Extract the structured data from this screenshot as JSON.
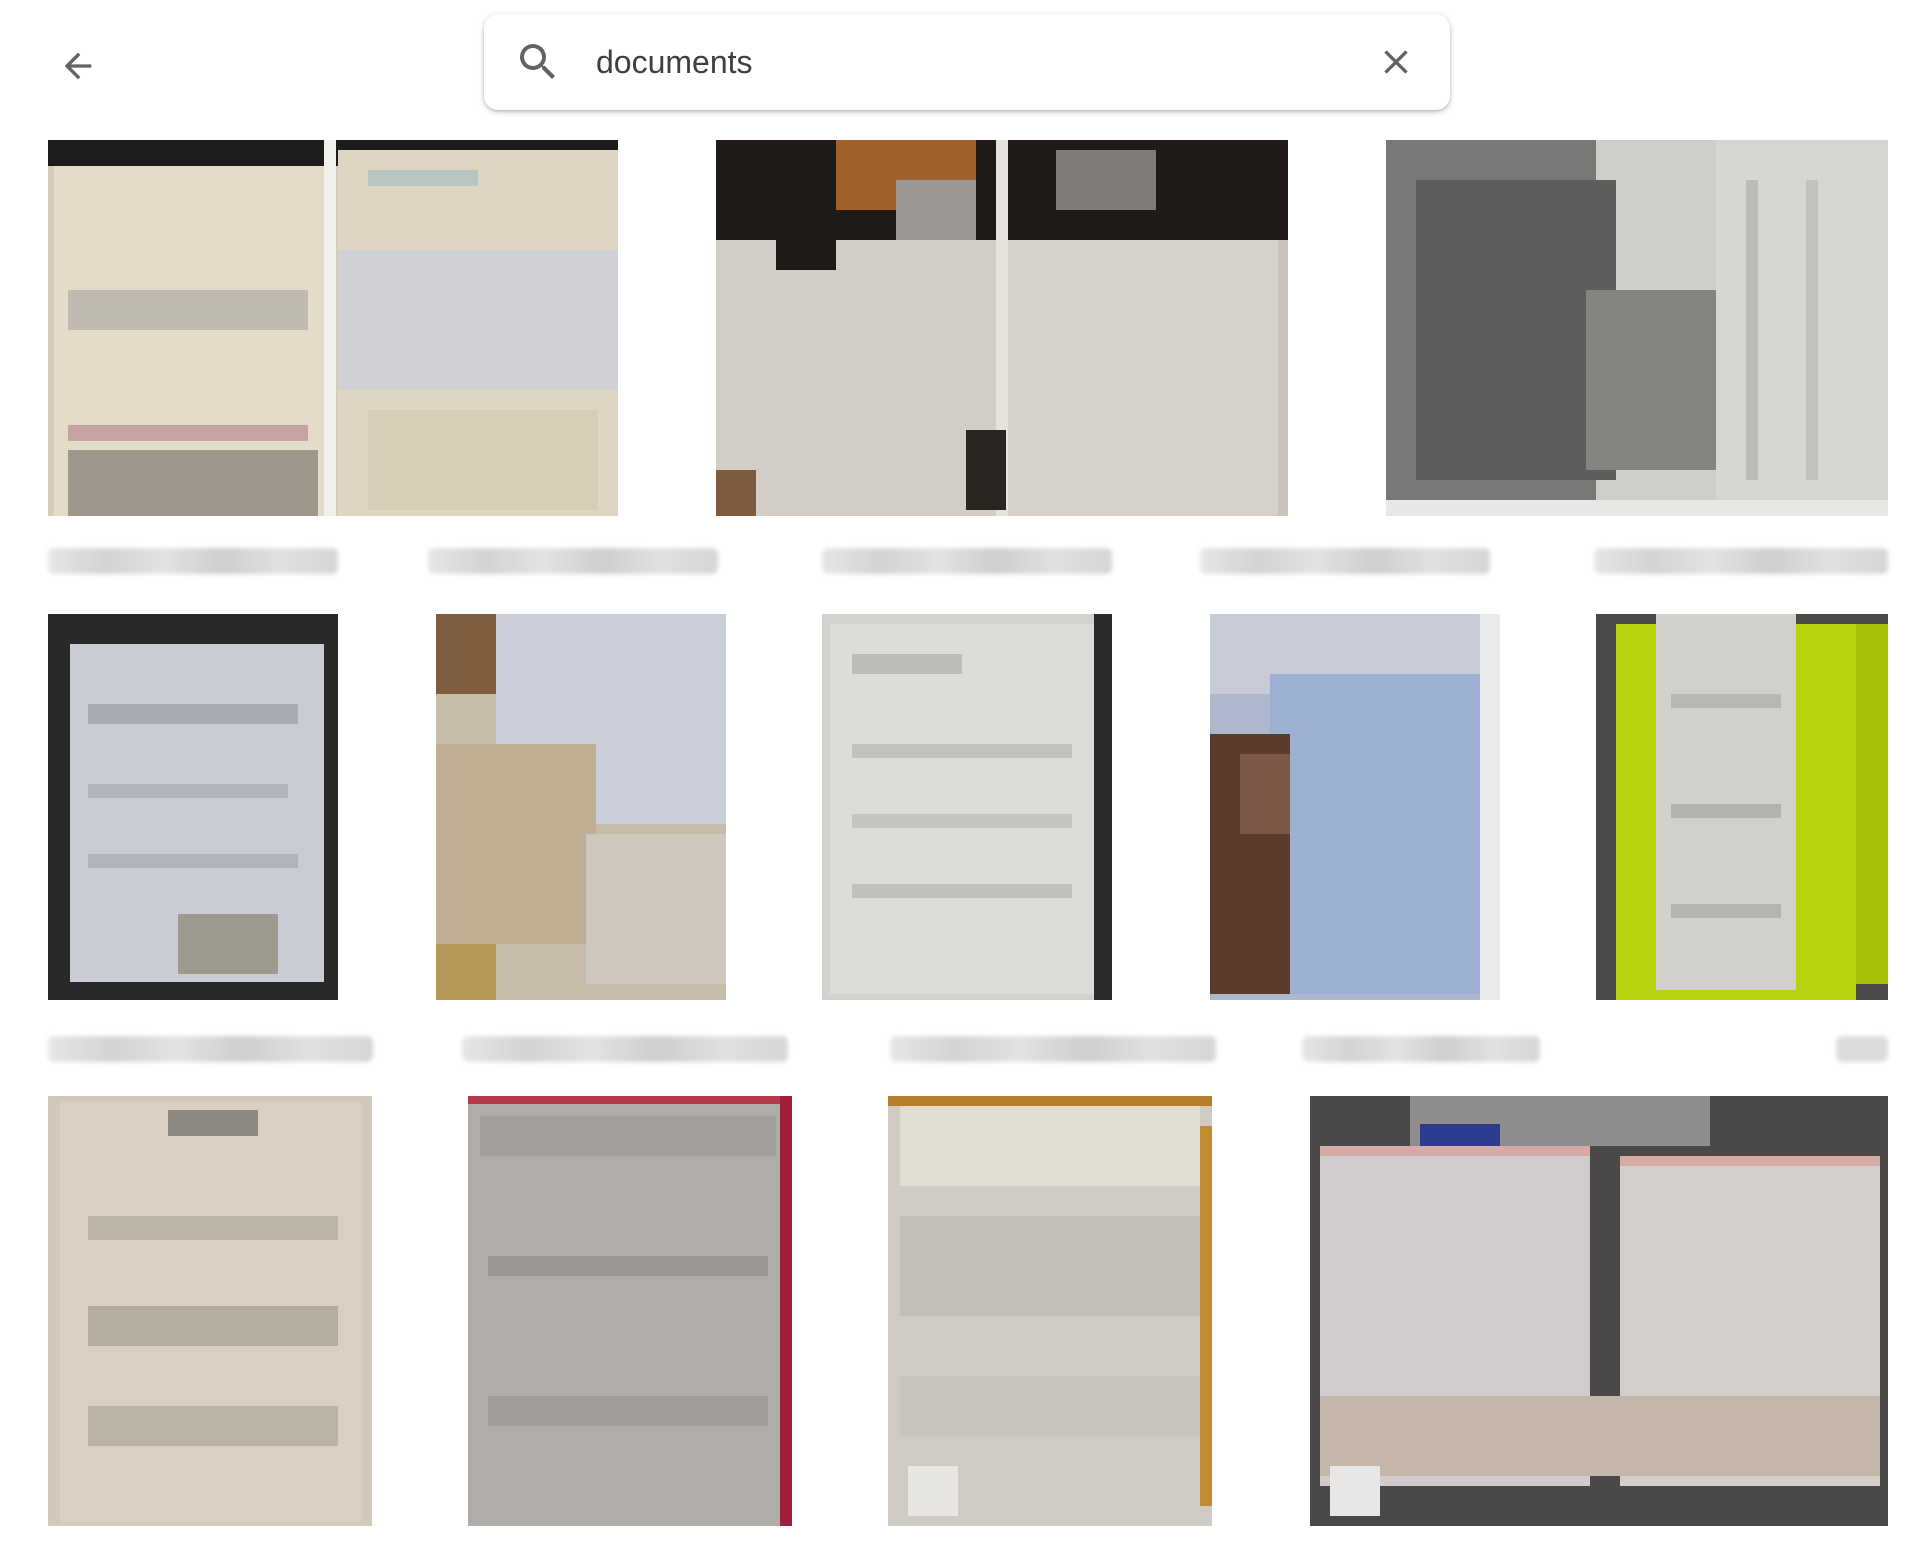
{
  "header": {
    "back_icon": "arrow-back-icon",
    "search": {
      "value": "documents",
      "icon": "search-icon",
      "clear_icon": "close-icon"
    }
  },
  "colors": {
    "icon": "#5f6368",
    "text": "#3c4043",
    "background": "#ffffff"
  }
}
